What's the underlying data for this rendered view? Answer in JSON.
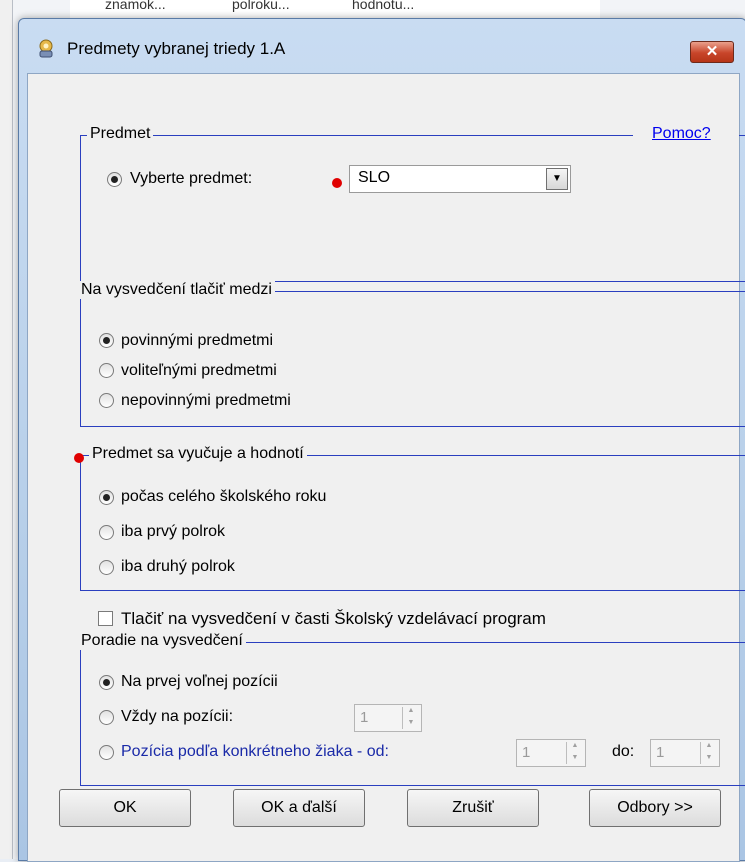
{
  "background": {
    "columns": [
      "znamok...",
      "polroku...",
      "hodnotu..."
    ]
  },
  "window": {
    "title": "Predmety vybranej triedy 1.A",
    "close_label": "✕"
  },
  "help_link": "Pomoc?",
  "predmet": {
    "legend": "Predmet",
    "radio_label": "Vyberte predmet:",
    "selected_value": "SLO"
  },
  "tlacit": {
    "legend": "Na vysvedčení tlačiť medzi",
    "options": [
      "povinnými predmetmi",
      "voliteľnými predmetmi",
      "nepovinnými predmetmi"
    ]
  },
  "vyucuje": {
    "legend": "Predmet sa vyučuje a hodnotí",
    "options": [
      "počas celého školského roku",
      "iba prvý polrok",
      "iba druhý polrok"
    ]
  },
  "checkbox_label": "Tlačiť na vysvedčení v časti Školský vzdelávací program",
  "poradie": {
    "legend": "Poradie na vysvedčení",
    "options": [
      "Na prvej voľnej pozícii",
      "Vždy na pozícii:",
      "Pozícia podľa konkrétneho žiaka - od:"
    ],
    "position_value": "1",
    "from_value": "1",
    "to_label": "do:",
    "to_value": "1"
  },
  "buttons": {
    "ok": "OK",
    "ok_next": "OK a ďalší",
    "cancel": "Zrušiť",
    "odbory": "Odbory >>"
  },
  "colors": {
    "group_border": "#2a3fbf",
    "link": "#0000ee",
    "required_dot": "#e00000",
    "close_button": "#c8452a"
  }
}
